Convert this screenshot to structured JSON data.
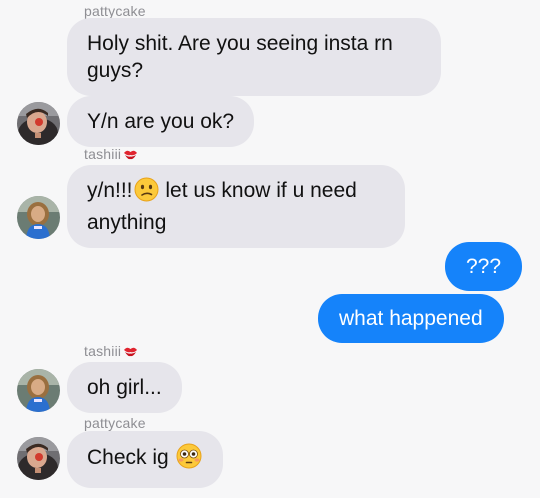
{
  "colors": {
    "background": "#f7f7f8",
    "incoming_bubble": "#e6e5eb",
    "outgoing_bubble": "#1583fa",
    "sender_name": "#8e8e93"
  },
  "messages": [
    {
      "sender": "pattycake",
      "text": "Holy shit. Are you seeing insta rn guys?"
    },
    {
      "sender": "pattycake",
      "text": "Y/n are you ok?"
    },
    {
      "sender": "tashiii",
      "sender_icon": "kiss-mark-icon",
      "text_before": "y/n!!!",
      "emoji": "confused-face-icon",
      "text_after": "let us know if u need anything"
    },
    {
      "sender": "me",
      "text": "???"
    },
    {
      "sender": "me",
      "text": "what happened"
    },
    {
      "sender": "tashiii",
      "sender_icon": "kiss-mark-icon",
      "text": "oh girl..."
    },
    {
      "sender": "pattycake",
      "text_before": "Check ig",
      "emoji": "flushed-face-icon"
    }
  ]
}
